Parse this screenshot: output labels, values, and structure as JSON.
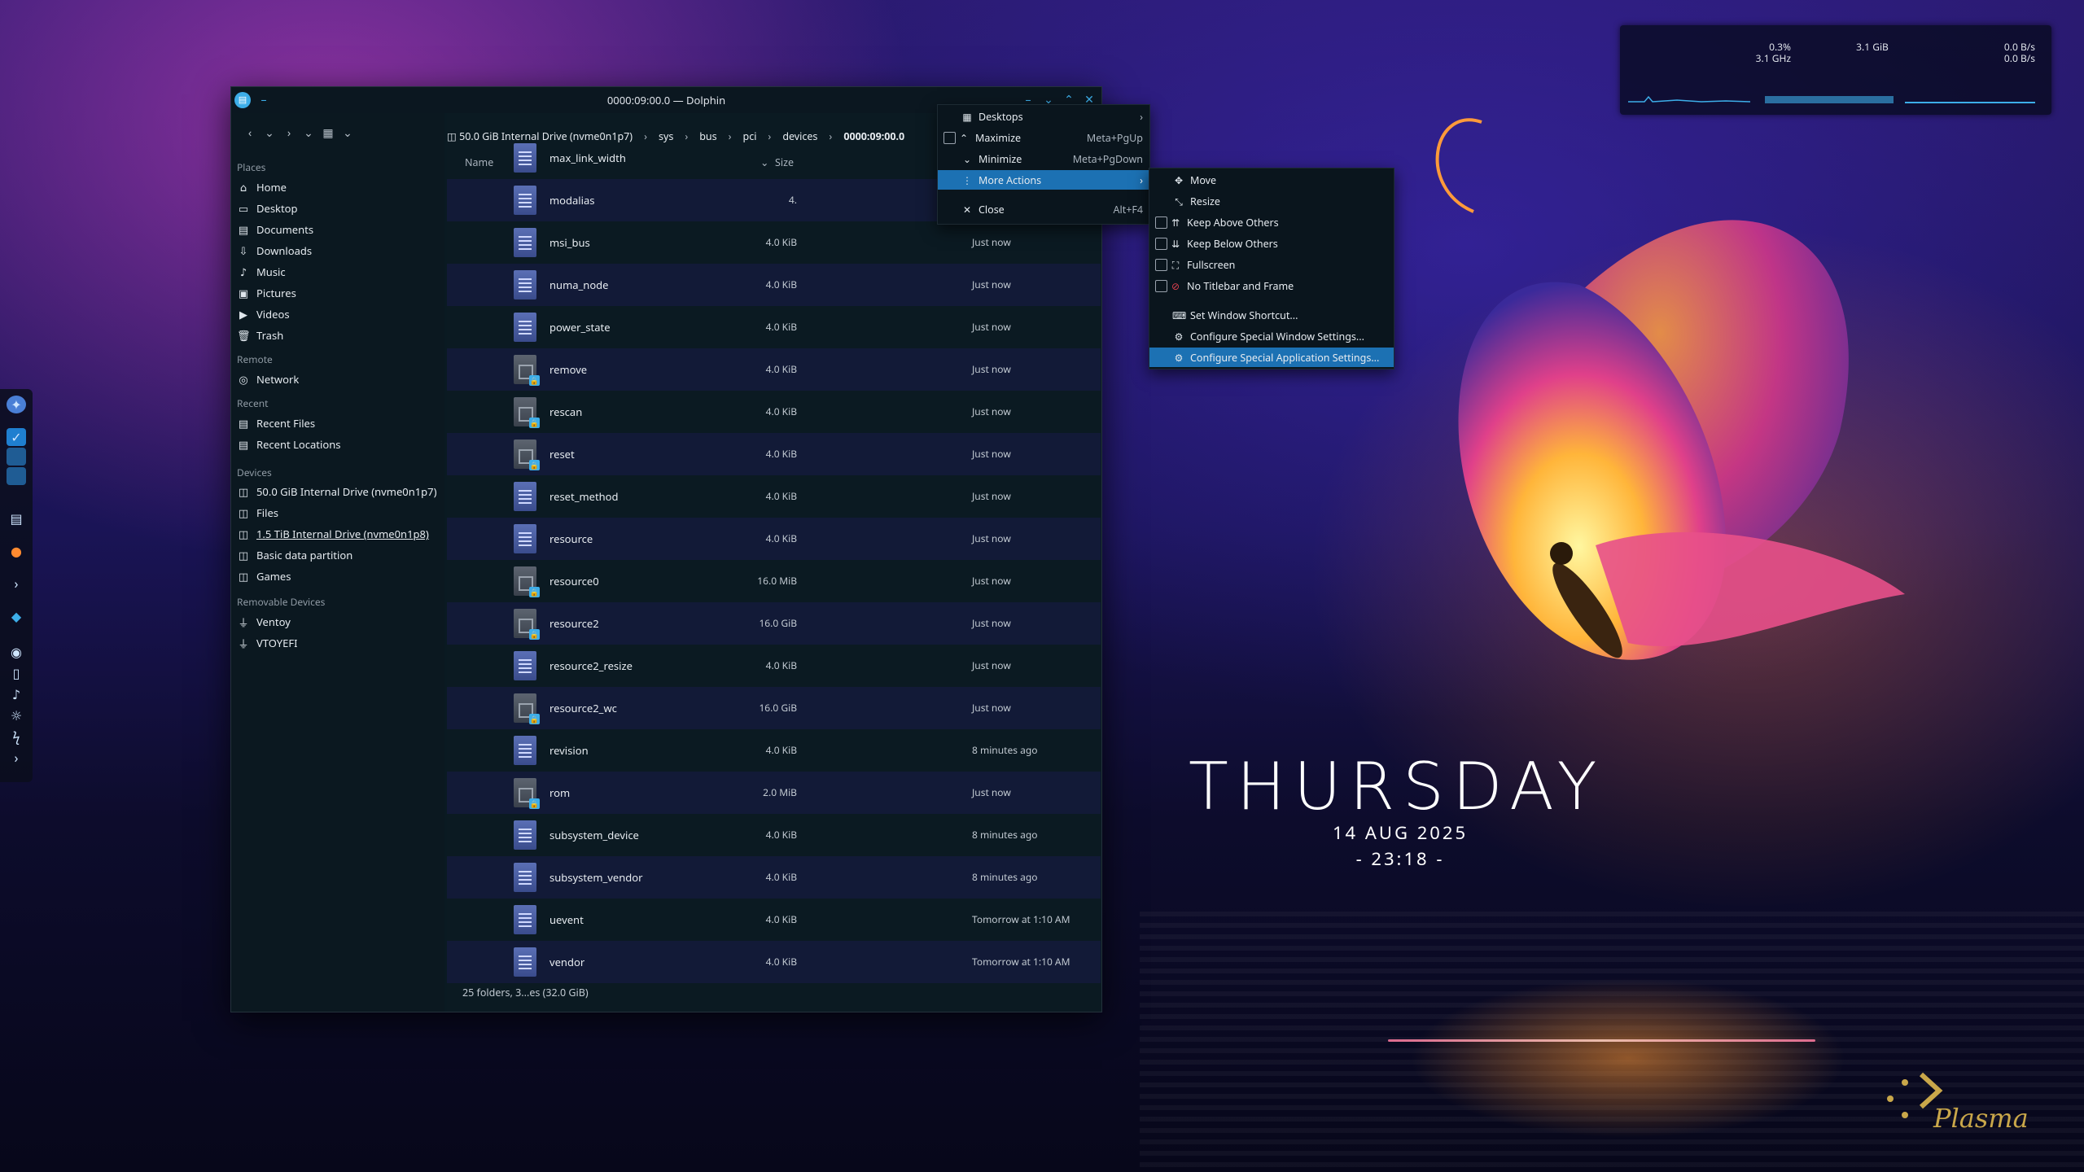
{
  "window": {
    "title": "0000:09:00.0 — Dolphin",
    "breadcrumbs": [
      "50.0 GiB Internal Drive (nvme0n1p7)",
      "sys",
      "bus",
      "pci",
      "devices",
      "0000:09:00.0"
    ],
    "columns": {
      "name": "Name",
      "size": "Size"
    },
    "status": "25 folders, 3...es (32.0 GiB)"
  },
  "sidebar": {
    "places_title": "Places",
    "places": [
      {
        "label": "Home",
        "icon": "home-icon"
      },
      {
        "label": "Desktop",
        "icon": "desktop-icon"
      },
      {
        "label": "Documents",
        "icon": "documents-icon"
      },
      {
        "label": "Downloads",
        "icon": "downloads-icon"
      },
      {
        "label": "Music",
        "icon": "music-icon"
      },
      {
        "label": "Pictures",
        "icon": "pictures-icon"
      },
      {
        "label": "Videos",
        "icon": "videos-icon"
      },
      {
        "label": "Trash",
        "icon": "trash-icon"
      }
    ],
    "remote_title": "Remote",
    "remote": [
      {
        "label": "Network",
        "icon": "network-icon"
      }
    ],
    "recent_title": "Recent",
    "recent": [
      {
        "label": "Recent Files",
        "icon": "recent-files-icon"
      },
      {
        "label": "Recent Locations",
        "icon": "recent-locations-icon"
      }
    ],
    "devices_title": "Devices",
    "devices": [
      {
        "label": "50.0 GiB Internal Drive (nvme0n1p7)",
        "icon": "drive-icon"
      },
      {
        "label": "Files",
        "icon": "drive-icon"
      },
      {
        "label": "1.5 TiB Internal Drive (nvme0n1p8)",
        "icon": "drive-icon"
      },
      {
        "label": "Basic data partition",
        "icon": "drive-icon"
      },
      {
        "label": "Games",
        "icon": "drive-icon"
      }
    ],
    "removable_title": "Removable Devices",
    "removable": [
      {
        "label": "Ventoy",
        "icon": "usb-icon"
      },
      {
        "label": "VTOYEFI",
        "icon": "usb-icon"
      }
    ]
  },
  "files": [
    {
      "name": "max_link_width",
      "size": "",
      "modified": "",
      "type": "text"
    },
    {
      "name": "modalias",
      "size": "4.",
      "modified": "",
      "type": "text"
    },
    {
      "name": "msi_bus",
      "size": "4.0 KiB",
      "modified": "Just now",
      "type": "text"
    },
    {
      "name": "numa_node",
      "size": "4.0 KiB",
      "modified": "Just now",
      "type": "text"
    },
    {
      "name": "power_state",
      "size": "4.0 KiB",
      "modified": "Just now",
      "type": "text"
    },
    {
      "name": "remove",
      "size": "4.0 KiB",
      "modified": "Just now",
      "type": "bin"
    },
    {
      "name": "rescan",
      "size": "4.0 KiB",
      "modified": "Just now",
      "type": "bin"
    },
    {
      "name": "reset",
      "size": "4.0 KiB",
      "modified": "Just now",
      "type": "bin"
    },
    {
      "name": "reset_method",
      "size": "4.0 KiB",
      "modified": "Just now",
      "type": "text"
    },
    {
      "name": "resource",
      "size": "4.0 KiB",
      "modified": "Just now",
      "type": "text"
    },
    {
      "name": "resource0",
      "size": "16.0 MiB",
      "modified": "Just now",
      "type": "bin"
    },
    {
      "name": "resource2",
      "size": "16.0 GiB",
      "modified": "Just now",
      "type": "bin"
    },
    {
      "name": "resource2_resize",
      "size": "4.0 KiB",
      "modified": "Just now",
      "type": "text"
    },
    {
      "name": "resource2_wc",
      "size": "16.0 GiB",
      "modified": "Just now",
      "type": "bin"
    },
    {
      "name": "revision",
      "size": "4.0 KiB",
      "modified": "8 minutes ago",
      "type": "text"
    },
    {
      "name": "rom",
      "size": "2.0 MiB",
      "modified": "Just now",
      "type": "bin"
    },
    {
      "name": "subsystem_device",
      "size": "4.0 KiB",
      "modified": "8 minutes ago",
      "type": "text"
    },
    {
      "name": "subsystem_vendor",
      "size": "4.0 KiB",
      "modified": "8 minutes ago",
      "type": "text"
    },
    {
      "name": "uevent",
      "size": "4.0 KiB",
      "modified": "Tomorrow at 1:10 AM",
      "type": "text"
    },
    {
      "name": "vendor",
      "size": "4.0 KiB",
      "modified": "Tomorrow at 1:10 AM",
      "type": "text"
    }
  ],
  "menu1": [
    {
      "label": "Desktops",
      "icon": "desktops-icon",
      "shortcut": "",
      "submenu": true
    },
    {
      "label": "Maximize",
      "icon": "maximize-icon",
      "shortcut": "Meta+PgUp",
      "checkbox": true
    },
    {
      "label": "Minimize",
      "icon": "minimize-icon",
      "shortcut": "Meta+PgDown"
    },
    {
      "label": "More Actions",
      "icon": "more-icon",
      "shortcut": "",
      "submenu": true,
      "highlight": true
    },
    {
      "label": "Close",
      "icon": "close-icon",
      "shortcut": "Alt+F4"
    }
  ],
  "menu2": [
    {
      "label": "Move",
      "icon": "move-icon"
    },
    {
      "label": "Resize",
      "icon": "resize-icon"
    },
    {
      "label": "Keep Above Others",
      "icon": "keep-above-icon",
      "checkbox": true
    },
    {
      "label": "Keep Below Others",
      "icon": "keep-below-icon",
      "checkbox": true
    },
    {
      "label": "Fullscreen",
      "icon": "fullscreen-icon",
      "checkbox": true
    },
    {
      "label": "No Titlebar and Frame",
      "icon": "no-titlebar-icon",
      "checkbox": true
    },
    {
      "label": "Set Window Shortcut...",
      "icon": "keyboard-icon"
    },
    {
      "label": "Configure Special Window Settings...",
      "icon": "settings-icon"
    },
    {
      "label": "Configure Special Application Settings...",
      "icon": "settings-icon",
      "highlight": true
    }
  ],
  "sysmon": {
    "cpu": "0.3%",
    "cpu_freq": "3.1 GHz",
    "mem": "3.1 GiB",
    "net_down": "0.0 B/s",
    "net_up": "0.0 B/s"
  },
  "clock": {
    "day": "THURSDAY",
    "date": "14 AUG 2025",
    "time": "- 23:18 -"
  },
  "brand": "Plasma",
  "colors": {
    "accent": "#3daee9",
    "highlight": "#1c71b3"
  }
}
